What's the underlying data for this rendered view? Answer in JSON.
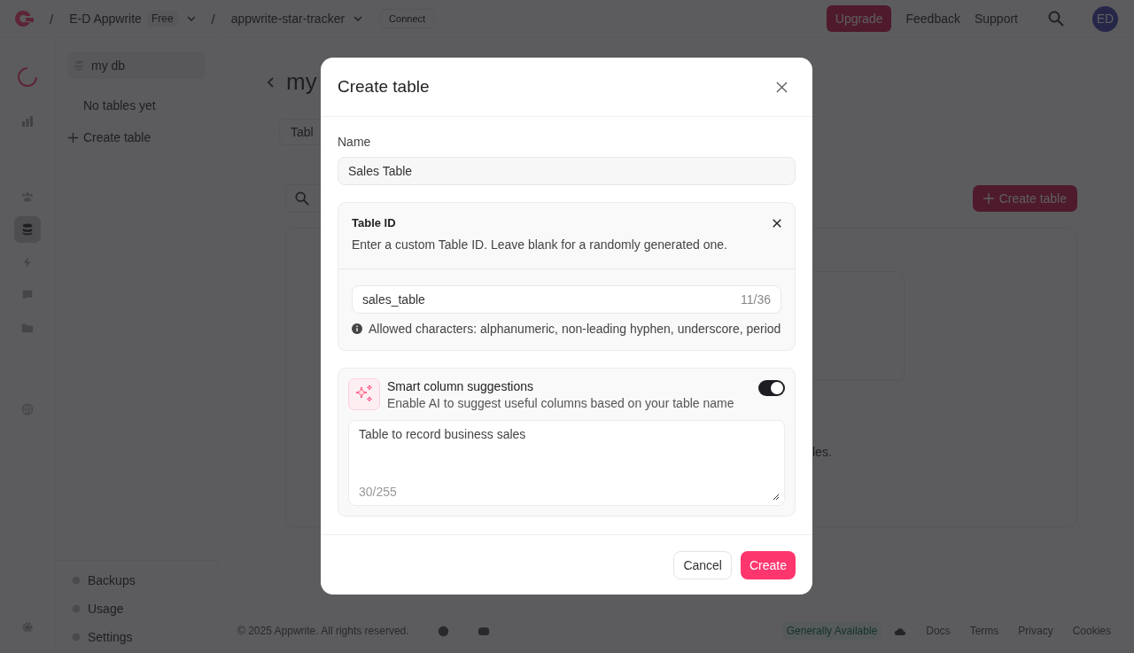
{
  "topbar": {
    "separators": [
      "/",
      "/"
    ],
    "org": "E-D Appwrite",
    "plan": "Free",
    "project": "appwrite-star-tracker",
    "connect": "Connect",
    "upgrade": "Upgrade",
    "feedback": "Feedback",
    "support": "Support",
    "avatar": "ED"
  },
  "rail": [
    {
      "selected": false
    },
    {
      "selected": true
    },
    {
      "selected": false
    },
    {
      "selected": false
    },
    {
      "selected": false
    },
    {
      "selected": false
    }
  ],
  "sidebar": {
    "database": "my db",
    "empty": "No tables yet",
    "create": "Create table",
    "bottom": [
      "Backups",
      "Usage",
      "Settings"
    ]
  },
  "page": {
    "title": "my",
    "tab": "Tabl",
    "create_button": "Create table",
    "empty_text": "les."
  },
  "footer": {
    "copyright": "© 2025 Appwrite. All rights reserved.",
    "status": "Generally Available",
    "links": [
      "Docs",
      "Terms",
      "Privacy",
      "Cookies"
    ]
  },
  "dialog": {
    "title": "Create table",
    "name_label": "Name",
    "name_value": "Sales Table",
    "table_id": {
      "title": "Table ID",
      "description": "Enter a custom Table ID. Leave blank for a randomly generated one.",
      "value": "sales_table",
      "count": "11/36",
      "hint": "Allowed characters: alphanumeric, non-leading hyphen, underscore, period"
    },
    "smart": {
      "title": "Smart column suggestions",
      "description": "Enable AI to suggest useful columns based on your table name",
      "on": true,
      "prompt": "Table to record business sales",
      "count": "30/255"
    },
    "cancel": "Cancel",
    "create": "Create"
  }
}
